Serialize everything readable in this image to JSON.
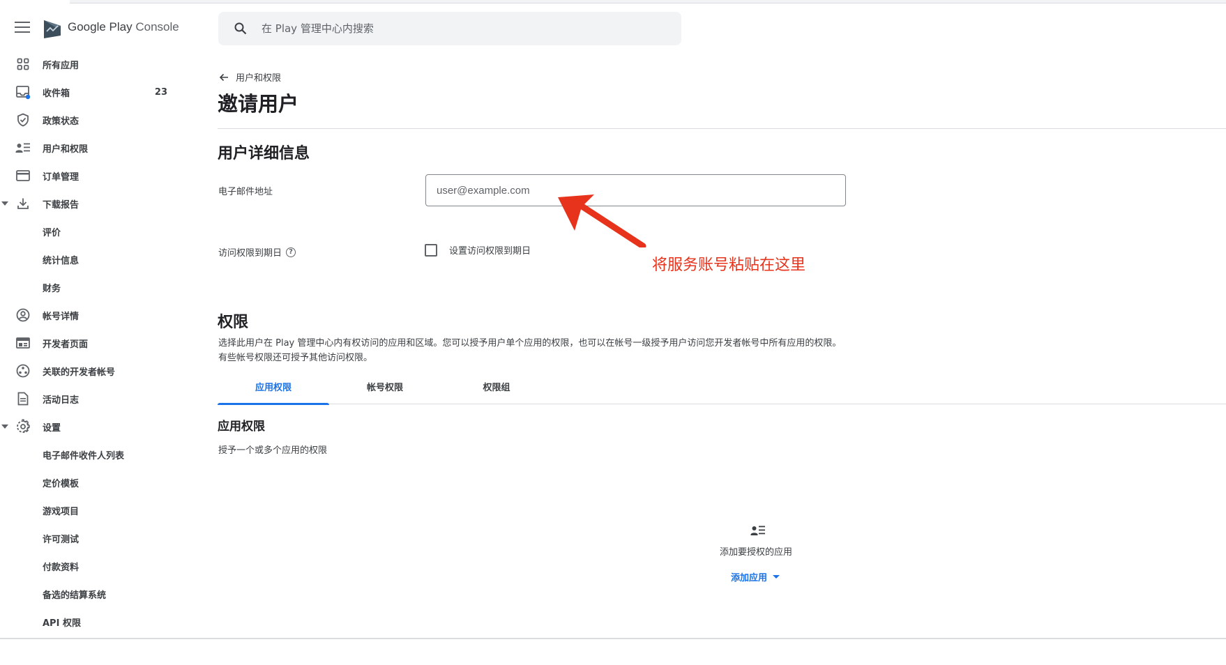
{
  "app": {
    "brand_main": "Google Play",
    "brand_light": "Console"
  },
  "search": {
    "placeholder": "在 Play 管理中心内搜索"
  },
  "sidebar": {
    "items": [
      {
        "label": "所有应用",
        "icon": "grid-icon"
      },
      {
        "label": "收件箱",
        "icon": "inbox-icon",
        "count": "23"
      },
      {
        "label": "政策状态",
        "icon": "shield-icon"
      },
      {
        "label": "用户和权限",
        "icon": "user-list-icon"
      },
      {
        "label": "订单管理",
        "icon": "credit-card-icon"
      },
      {
        "label": "下载报告",
        "icon": "download-icon"
      },
      {
        "label": "评价"
      },
      {
        "label": "统计信息"
      },
      {
        "label": "财务"
      },
      {
        "label": "帐号详情",
        "icon": "account-circle-icon"
      },
      {
        "label": "开发者页面",
        "icon": "web-page-icon"
      },
      {
        "label": "关联的开发者帐号",
        "icon": "linked-accounts-icon"
      },
      {
        "label": "活动日志",
        "icon": "document-icon"
      },
      {
        "label": "设置",
        "icon": "gear-icon"
      },
      {
        "label": "电子邮件收件人列表"
      },
      {
        "label": "定价模板"
      },
      {
        "label": "游戏项目"
      },
      {
        "label": "许可测试"
      },
      {
        "label": "付款资料"
      },
      {
        "label": "备选的结算系统"
      },
      {
        "label": "API 权限"
      }
    ]
  },
  "main": {
    "breadcrumb": "用户和权限",
    "page_title": "邀请用户",
    "details": {
      "title": "用户详细信息",
      "email_label": "电子邮件地址",
      "email_placeholder": "user@example.com",
      "expiry_label": "访问权限到期日",
      "expiry_checkbox_label": "设置访问权限到期日"
    },
    "annotation": "将服务账号粘贴在这里",
    "permissions": {
      "title": "权限",
      "description": "选择此用户在 Play 管理中心内有权访问的应用和区域。您可以授予用户单个应用的权限，也可以在帐号一级授予用户访问您开发者帐号中所有应用的权限。有些帐号权限还可授予其他访问权限。",
      "tabs": [
        "应用权限",
        "帐号权限",
        "权限组"
      ],
      "active_tab": "应用权限",
      "app_perm_title": "应用权限",
      "app_perm_desc": "授予一个或多个应用的权限",
      "empty_text": "添加要授权的应用",
      "add_app_label": "添加应用"
    }
  },
  "colors": {
    "accent": "#1a73e8",
    "annotation": "#e8331c"
  }
}
